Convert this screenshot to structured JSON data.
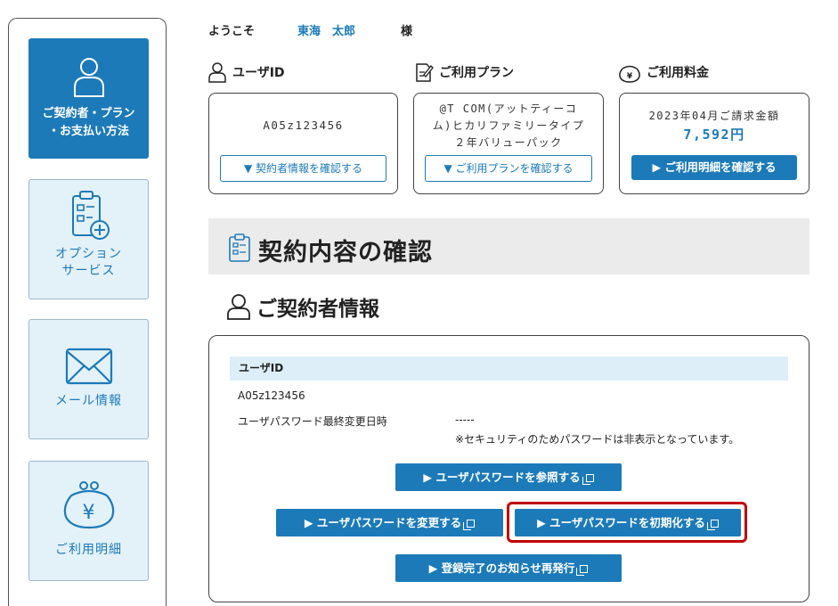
{
  "welcome": {
    "greeting": "ようこそ",
    "user_name": "東海　太郎",
    "suffix": "様"
  },
  "sidebar": {
    "items": [
      {
        "label": "ご契約者・プラン\n・お支払い方法",
        "icon": "person-icon",
        "active": true
      },
      {
        "label": "オプション\nサービス",
        "icon": "clipboard-plus-icon",
        "active": false
      },
      {
        "label": "メール情報",
        "icon": "envelope-icon",
        "active": false
      },
      {
        "label": "ご利用明細",
        "icon": "yen-purse-icon",
        "active": false
      }
    ]
  },
  "summary": {
    "user_id": {
      "label": "ユーザID",
      "value": "A05z123456",
      "button": "▼ 契約者情報を確認する"
    },
    "plan": {
      "label": "ご利用プラン",
      "lines": [
        "@T COM(アットティーコ",
        "ム)ヒカリファミリータイプ",
        "２年バリューパック"
      ],
      "button": "▼ ご利用プランを確認する"
    },
    "fee": {
      "label": "ご利用料金",
      "period": "2023年04月ご請求金額",
      "amount": "7,592円",
      "button": "▶ ご利用明細を確認する"
    }
  },
  "page": {
    "title": "契約内容の確認",
    "section": "ご契約者情報"
  },
  "contract": {
    "band_label": "ユーザID",
    "user_id": "A05z123456",
    "pw_label": "ユーザパスワード最終変更日時",
    "pw_value": "-----",
    "pw_note": "※セキュリティのためパスワードは非表示となっています。",
    "buttons": {
      "view": "▶ ユーザパスワードを参照する",
      "change": "▶ ユーザパスワードを変更する",
      "reset": "▶ ユーザパスワードを初期化する",
      "reissue": "▶ 登録完了のお知らせ再発行"
    }
  },
  "colors": {
    "accent": "#1c7ab9",
    "highlight": "#c00000",
    "band": "#ddeef8"
  }
}
